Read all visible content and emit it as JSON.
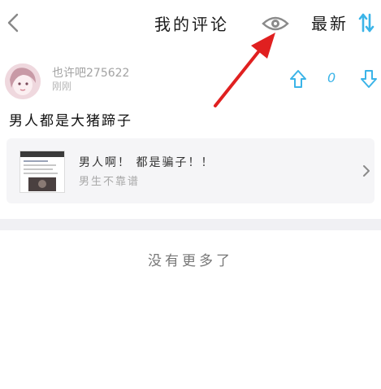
{
  "header": {
    "back_icon": "chevron-left-icon",
    "title": "我的评论",
    "view_icon": "eye-icon",
    "sort_label": "最新",
    "sort_icon": "sort-arrows-icon",
    "accent_color": "#3bb4e8"
  },
  "annotation": {
    "arrow_color": "#e02020"
  },
  "comment": {
    "username": "也许吧275622",
    "timestamp": "刚刚",
    "text": "男人都是大猪蹄子",
    "vote_count": "0",
    "up_icon": "arrow-up-icon",
    "down_icon": "arrow-down-icon"
  },
  "post": {
    "title": "男人啊！ 都是骗子！！",
    "subtitle": "男生不靠谱",
    "chevron_icon": "chevron-right-icon"
  },
  "footer": {
    "end_text": "没有更多了"
  }
}
